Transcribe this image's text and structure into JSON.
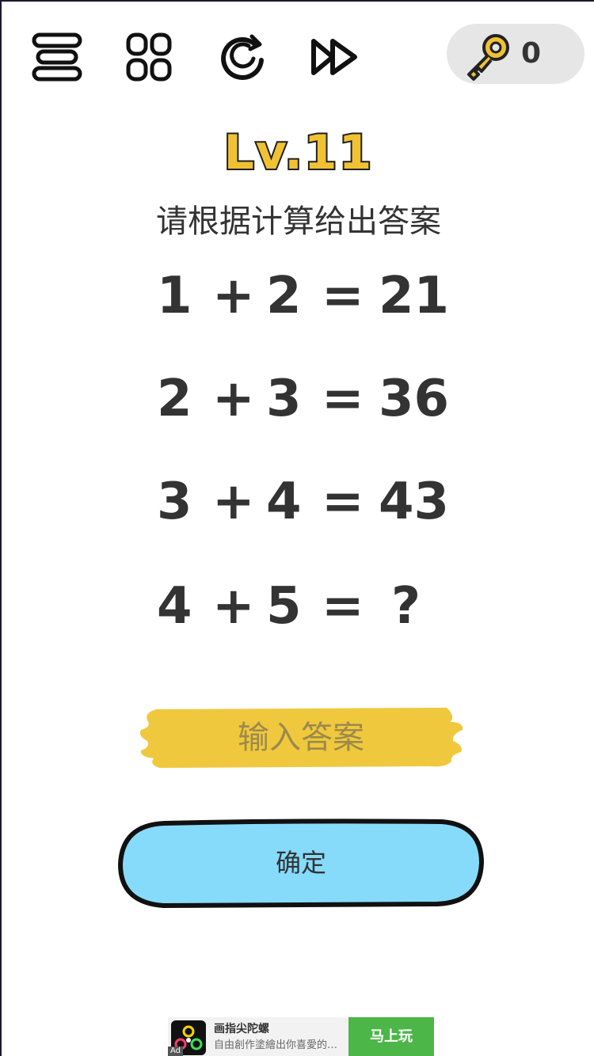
{
  "toolbar": {
    "menu_icon": "menu-icon",
    "levels_icon": "grid-icon",
    "restart_icon": "restart-icon",
    "skip_icon": "fast-forward-icon"
  },
  "keys": {
    "icon": "key-icon",
    "count": "0"
  },
  "level": {
    "title": "Lv.11",
    "instruction": "请根据计算给出答案"
  },
  "puzzle": {
    "equations": [
      {
        "a": "1",
        "op": "+",
        "b": "2",
        "eq": "=",
        "result": "21"
      },
      {
        "a": "2",
        "op": "+",
        "b": "3",
        "eq": "=",
        "result": "36"
      },
      {
        "a": "3",
        "op": "+",
        "b": "4",
        "eq": "=",
        "result": "43"
      },
      {
        "a": "4",
        "op": "+",
        "b": "5",
        "eq": "=",
        "result": "?"
      }
    ]
  },
  "answer": {
    "placeholder": "输入答案",
    "value": ""
  },
  "confirm": {
    "label": "确定"
  },
  "ad": {
    "tag": "Ad",
    "title": "画指尖陀螺",
    "description": "自由創作塗繪出你喜愛的螢...",
    "cta": "马上玩"
  },
  "colors": {
    "level_fill": "#f0c233",
    "key_color": "#f0c233",
    "answer_bg": "#f0c83e",
    "confirm_bg": "#86dbfa",
    "ad_cta": "#4cb648",
    "key_pill": "#e6e6e6"
  }
}
